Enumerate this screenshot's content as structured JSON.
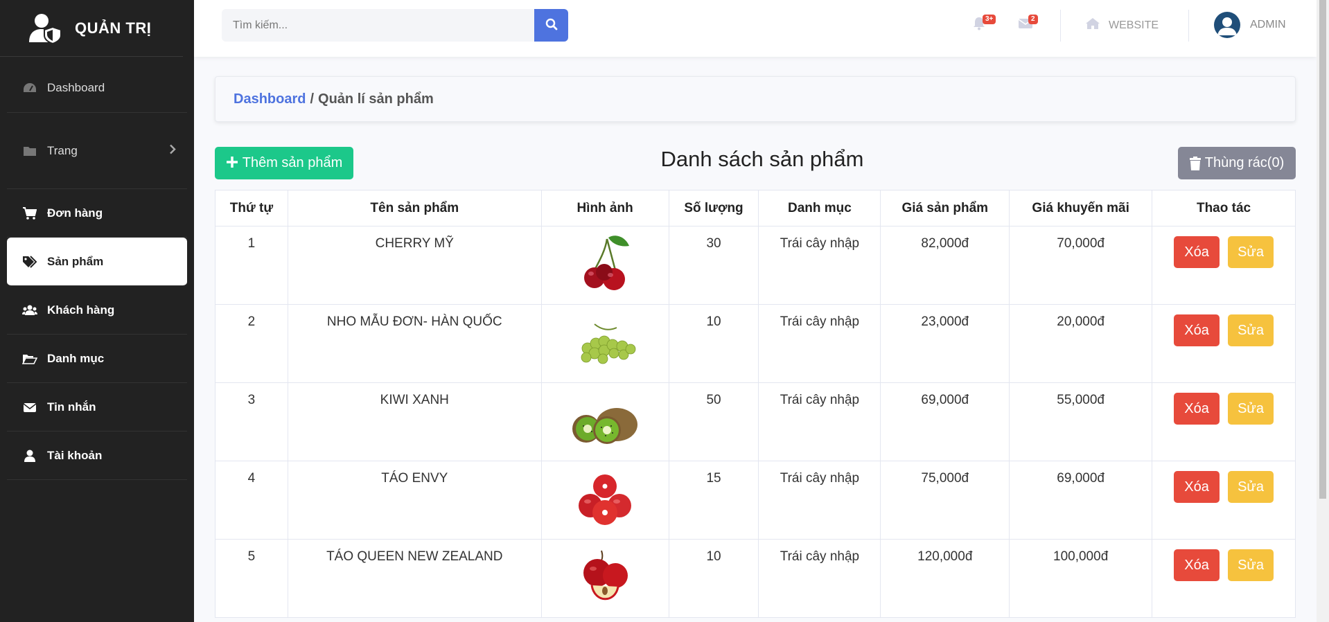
{
  "brand": {
    "title": "QUẢN TRỊ"
  },
  "sidebar": {
    "items": [
      {
        "label": "Dashboard",
        "icon": "tachometer-icon"
      },
      {
        "label": "Trang",
        "icon": "folder-icon"
      },
      {
        "label": "Đơn hàng",
        "icon": "cart-icon"
      },
      {
        "label": "Sản phẩm",
        "icon": "tags-icon"
      },
      {
        "label": "Khách hàng",
        "icon": "users-icon"
      },
      {
        "label": "Danh mục",
        "icon": "folder-open-icon"
      },
      {
        "label": "Tin nhắn",
        "icon": "envelope-icon"
      },
      {
        "label": "Tài khoản",
        "icon": "user-icon"
      }
    ]
  },
  "topbar": {
    "search_placeholder": "Tìm kiếm...",
    "alerts_badge": "3+",
    "messages_badge": "2",
    "website_label": "WEBSITE",
    "user_label": "ADMIN"
  },
  "breadcrumb": {
    "link": "Dashboard",
    "separator": "/",
    "current": "Quản lí sản phẩm"
  },
  "main": {
    "add_label": "Thêm sản phẩm",
    "title": "Danh sách sản phẩm",
    "trash_label": "Thùng rác(0)"
  },
  "table": {
    "headers": [
      "Thứ tự",
      "Tên sản phẩm",
      "Hình ảnh",
      "Số lượng",
      "Danh mục",
      "Giá sản phẩm",
      "Giá khuyến mãi",
      "Thao tác"
    ],
    "delete_label": "Xóa",
    "edit_label": "Sửa",
    "rows": [
      {
        "order": "1",
        "name": "CHERRY MỸ",
        "qty": "30",
        "category": "Trái cây nhập",
        "price": "82,000đ",
        "sale": "70,000đ",
        "image": "cherry"
      },
      {
        "order": "2",
        "name": "NHO MẪU ĐƠN- HÀN QUỐC",
        "qty": "10",
        "category": "Trái cây nhập",
        "price": "23,000đ",
        "sale": "20,000đ",
        "image": "grapes"
      },
      {
        "order": "3",
        "name": "KIWI XANH",
        "qty": "50",
        "category": "Trái cây nhập",
        "price": "69,000đ",
        "sale": "55,000đ",
        "image": "kiwi"
      },
      {
        "order": "4",
        "name": "TÁO ENVY",
        "qty": "15",
        "category": "Trái cây nhập",
        "price": "75,000đ",
        "sale": "69,000đ",
        "image": "envy-apple"
      },
      {
        "order": "5",
        "name": "TÁO QUEEN NEW ZEALAND",
        "qty": "10",
        "category": "Trái cây nhập",
        "price": "120,000đ",
        "sale": "100,000đ",
        "image": "red-apple"
      }
    ]
  },
  "colors": {
    "sidebar_bg": "#222222",
    "primary": "#4e73df",
    "success": "#1cc88a",
    "danger": "#e74a3b",
    "warning": "#f6c23e",
    "secondary": "#858796"
  }
}
